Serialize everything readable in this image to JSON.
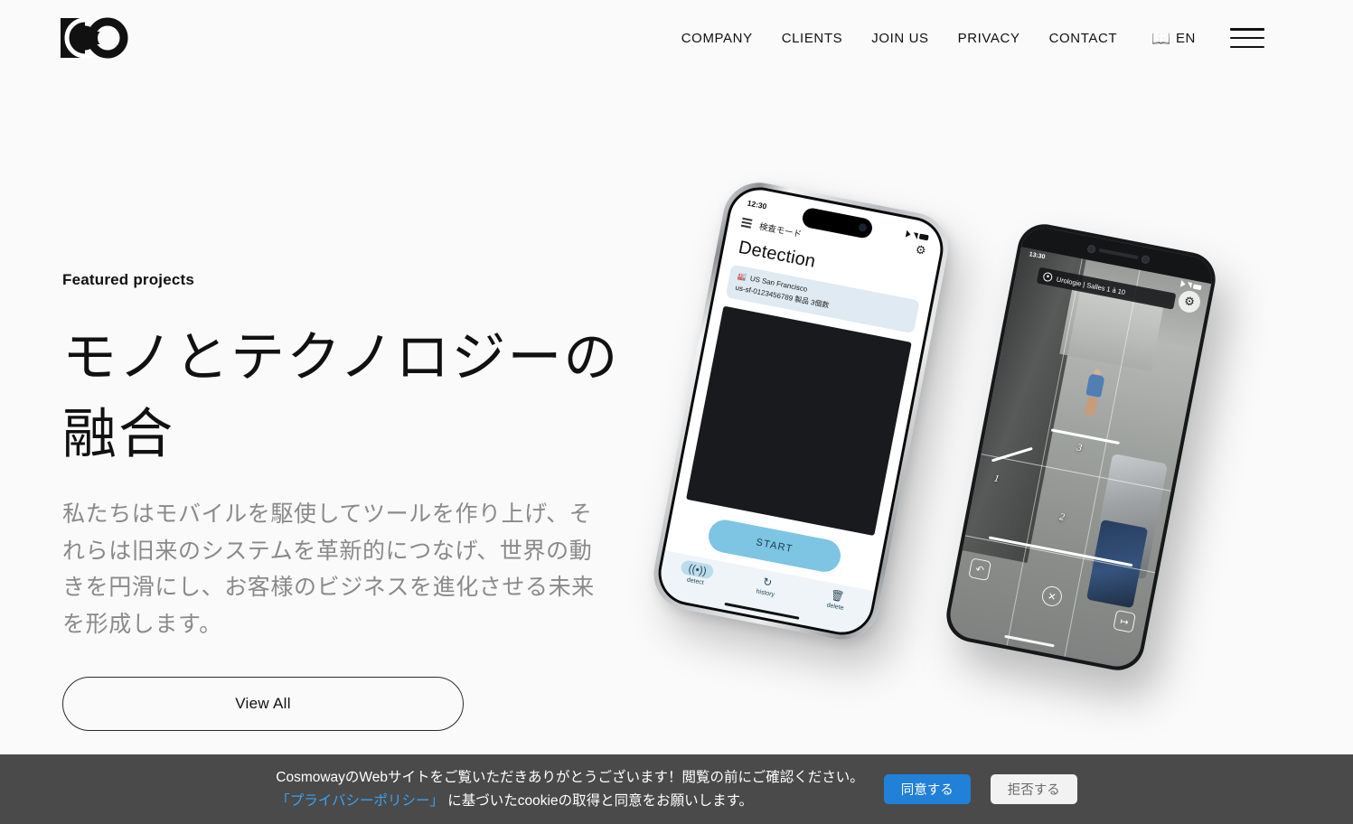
{
  "colors": {
    "page_bg": "#fafafa",
    "text": "#111111",
    "muted": "#8a8a8a",
    "cookie_bg": "#4a4a4a",
    "accent_blue": "#2180d8",
    "link_blue": "#3ea0ef",
    "phone_accent": "#7ec4e3"
  },
  "header": {
    "logo_name": "cosmoway-logo",
    "nav": [
      {
        "label": "COMPANY",
        "name": "nav-company"
      },
      {
        "label": "CLIENTS",
        "name": "nav-clients"
      },
      {
        "label": "JOIN US",
        "name": "nav-join-us"
      },
      {
        "label": "PRIVACY",
        "name": "nav-privacy"
      },
      {
        "label": "CONTACT",
        "name": "nav-contact"
      }
    ],
    "language": {
      "label": "EN",
      "icon": "translate-icon",
      "glyph": "📖"
    },
    "menu_icon": "hamburger-menu-icon"
  },
  "hero": {
    "eyebrow": "Featured projects",
    "headline": "モノとテクノロジーの融合",
    "lede": "私たちはモバイルを駆使してツールを作り上げ、それらは旧来のシステムを革新的につなげ、世界の動きを円滑にし、お客様のビジネスを進化させる未来を形成します。",
    "cta_label": "View All"
  },
  "phone1": {
    "status_time": "12:30",
    "mode_label": "検査モード",
    "title": "Detection",
    "card_location": "US San Francisco",
    "card_detail": "us-sf-0123456789 製品 3個数",
    "start_label": "START",
    "tabs": [
      {
        "label": "detect",
        "icon": "detect-icon",
        "glyph": "((•))",
        "active": true
      },
      {
        "label": "history",
        "icon": "history-icon",
        "glyph": "↺",
        "active": false
      },
      {
        "label": "delete",
        "icon": "trash-icon",
        "glyph": "Ὕ1",
        "active": false
      }
    ]
  },
  "phone2": {
    "status_time": "13:30",
    "chip_label": "Urologie | Salles 1 à 10",
    "measure_labels": [
      "1",
      "2",
      "3"
    ],
    "controls": [
      {
        "name": "undo-button",
        "glyph": "↶"
      },
      {
        "name": "cancel-button",
        "glyph": "✕"
      },
      {
        "name": "next-button",
        "glyph": "↦"
      }
    ],
    "settings_icon": "gear-icon"
  },
  "cookie": {
    "line1": "CosmowayのWebサイトをご覧いただきありがとうございます！閲覧の前にご確認ください。",
    "link_text": "「プライバシーポリシー」",
    "line2_rest": "に基づいたcookieの取得と同意をお願いします。",
    "accept_label": "同意する",
    "reject_label": "拒否する"
  }
}
